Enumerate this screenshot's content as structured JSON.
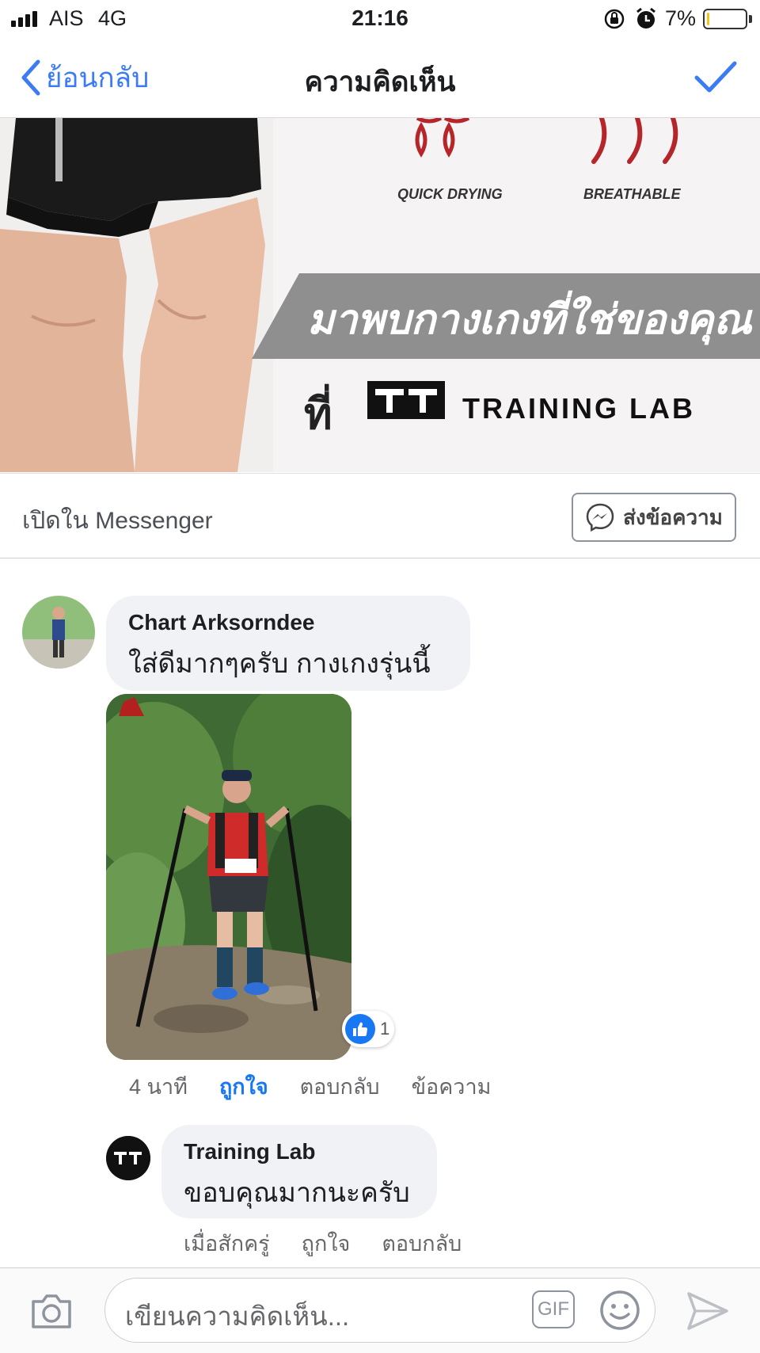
{
  "status_bar": {
    "carrier": "AIS",
    "network": "4G",
    "time": "21:16",
    "battery_percent": "7%",
    "battery_level": 0.07,
    "icons": [
      "signal-icon",
      "rotation-lock-icon",
      "alarm-icon",
      "battery-icon"
    ]
  },
  "nav": {
    "back_label": "ย้อนกลับ",
    "title": "ความคิดเห็น",
    "done_icon": "checkmark-icon",
    "accent": "#3b7cf5"
  },
  "banner": {
    "feature_1": "QUICK DRYING",
    "feature_2": "BREATHABLE",
    "headline": "มาพบกางเกงที่ใช่ของคุณ",
    "at": "ที่",
    "brand": "TRAINING LAB"
  },
  "messenger": {
    "text": "เปิดใน Messenger",
    "button_label": "ส่งข้อความ",
    "button_icon": "messenger-icon"
  },
  "comments": [
    {
      "author": "Chart Arksorndee",
      "text": "ใส่ดีมากๆครับ กางเกงรุ่นนี้",
      "has_photo": true,
      "reaction_count": "1",
      "reaction_icon": "thumbs-up-icon",
      "time": "4 นาที",
      "like": "ถูกใจ",
      "liked": true,
      "reply": "ตอบกลับ",
      "message": "ข้อความ"
    },
    {
      "author": "Training Lab",
      "text": "ขอบคุณมากนะครับ",
      "time": "เมื่อสักครู่",
      "like": "ถูกใจ",
      "liked": false,
      "reply": "ตอบกลับ"
    }
  ],
  "composer": {
    "placeholder": "เขียนความคิดเห็น...",
    "gif_label": "GIF",
    "icons": [
      "camera-icon",
      "gif-icon",
      "emoji-icon",
      "send-icon"
    ]
  }
}
